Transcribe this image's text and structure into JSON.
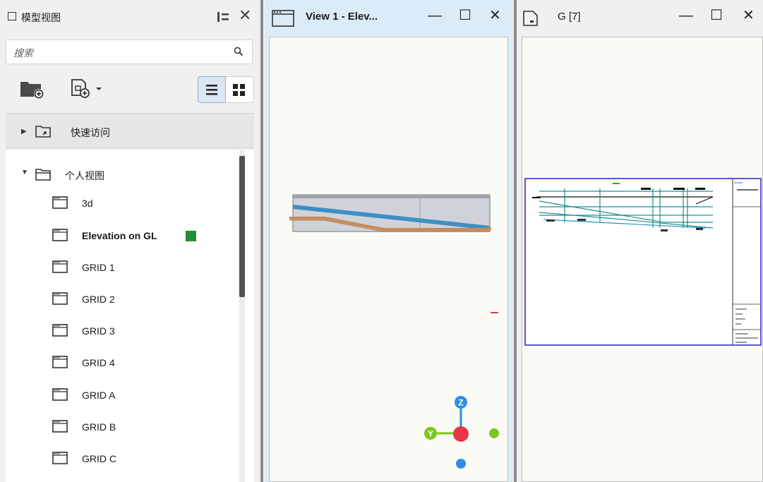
{
  "panel": {
    "title": "模型视图",
    "search_placeholder": "搜索",
    "quick_access_label": "快速访问",
    "group_label": "个人视图",
    "items": [
      {
        "label": "3d",
        "bold": false
      },
      {
        "label": "Elevation on GL",
        "bold": true
      },
      {
        "label": "GRID 1",
        "bold": false
      },
      {
        "label": "GRID 2",
        "bold": false
      },
      {
        "label": "GRID 3",
        "bold": false
      },
      {
        "label": "GRID 4",
        "bold": false
      },
      {
        "label": "GRID A",
        "bold": false
      },
      {
        "label": "GRID B",
        "bold": false
      },
      {
        "label": "GRID C",
        "bold": false
      }
    ],
    "active_color": "#1f8f3a"
  },
  "view1": {
    "title": "View 1 - Elev...",
    "axis_labels": {
      "z": "Z",
      "y": "Y"
    }
  },
  "view2": {
    "title": "G  [7]"
  },
  "window_controls": {
    "minimize": "—",
    "maximize": "☐",
    "close": "✕"
  },
  "colors": {
    "selected_tab_bg": "#dcebf8",
    "axis_z": "#2f8de4",
    "axis_y": "#7cc61e",
    "axis_x": "#e8344a"
  }
}
